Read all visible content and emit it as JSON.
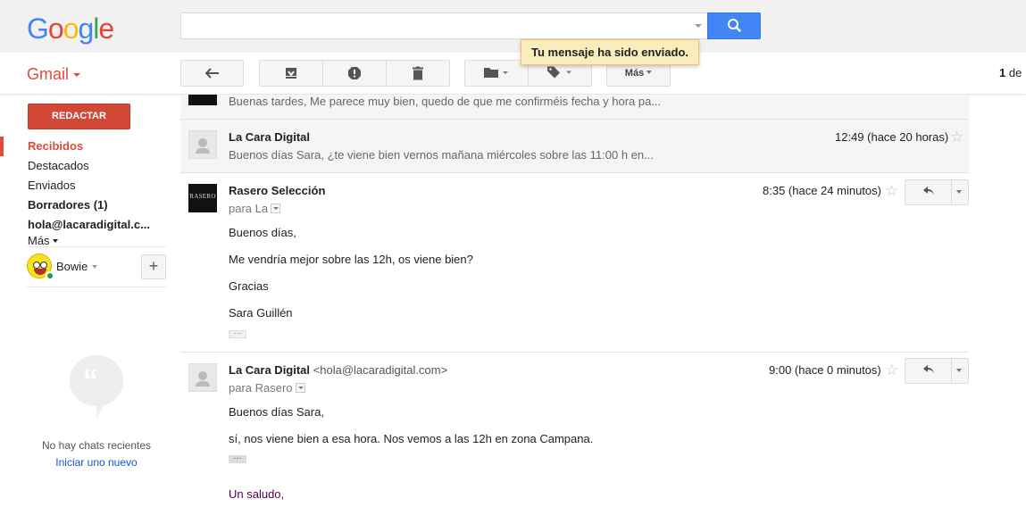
{
  "header": {
    "logo_letters": [
      {
        "ch": "G",
        "color": "#4285f4"
      },
      {
        "ch": "o",
        "color": "#ea4335"
      },
      {
        "ch": "o",
        "color": "#fbbc05"
      },
      {
        "ch": "g",
        "color": "#4285f4"
      },
      {
        "ch": "l",
        "color": "#34a853"
      },
      {
        "ch": "e",
        "color": "#ea4335"
      }
    ],
    "search_value": "",
    "toast": "Tu mensaje ha sido enviado."
  },
  "toolbar": {
    "app_label": "Gmail",
    "more_label": "Más",
    "page_count_bold": "1",
    "page_count_rest": " de"
  },
  "sidebar": {
    "compose_label": "REDACTAR",
    "items": [
      {
        "label": "Recibidos"
      },
      {
        "label": "Destacados"
      },
      {
        "label": "Enviados"
      },
      {
        "label": "Borradores (1)"
      },
      {
        "label": "hola@lacaradigital.c..."
      },
      {
        "label": "Más"
      }
    ],
    "chat_user": "Bowie",
    "no_chats": "No hay chats recientes",
    "start_new": "Iniciar uno nuevo"
  },
  "thread": {
    "top_snippet": "Buenas tardes, Me parece muy bien, quedo de que me confirméis fecha y hora pa...",
    "collapsed": {
      "sender": "La Cara Digital",
      "time": "12:49 (hace 20 horas)",
      "snippet": "Buenos días Sara, ¿te viene bien vernos mañana miércoles sobre las 11:00 h en..."
    },
    "msg1": {
      "brand": "RASERO",
      "sender": "Rasero Selección",
      "to": "para La",
      "time": "8:35 (hace 24 minutos)",
      "lines": [
        "Buenos días,",
        "Me vendría mejor sobre las 12h, os viene bien?",
        "Gracias",
        "Sara Guillén"
      ]
    },
    "msg2": {
      "sender": "La Cara Digital",
      "email": "<hola@lacaradigital.com>",
      "to": "para Rasero",
      "time": "9:00 (hace 0 minutos)",
      "lines": [
        "Buenos días Sara,",
        "sí, nos viene bien a esa hora. Nos vemos a las 12h en zona Campana."
      ],
      "closing": "Un saludo,"
    }
  },
  "colors": {
    "brand_red": "#dd4b39",
    "search_blue": "#4285f4",
    "link_blue": "#1155cc",
    "toast_bg": "#f9edbe"
  }
}
